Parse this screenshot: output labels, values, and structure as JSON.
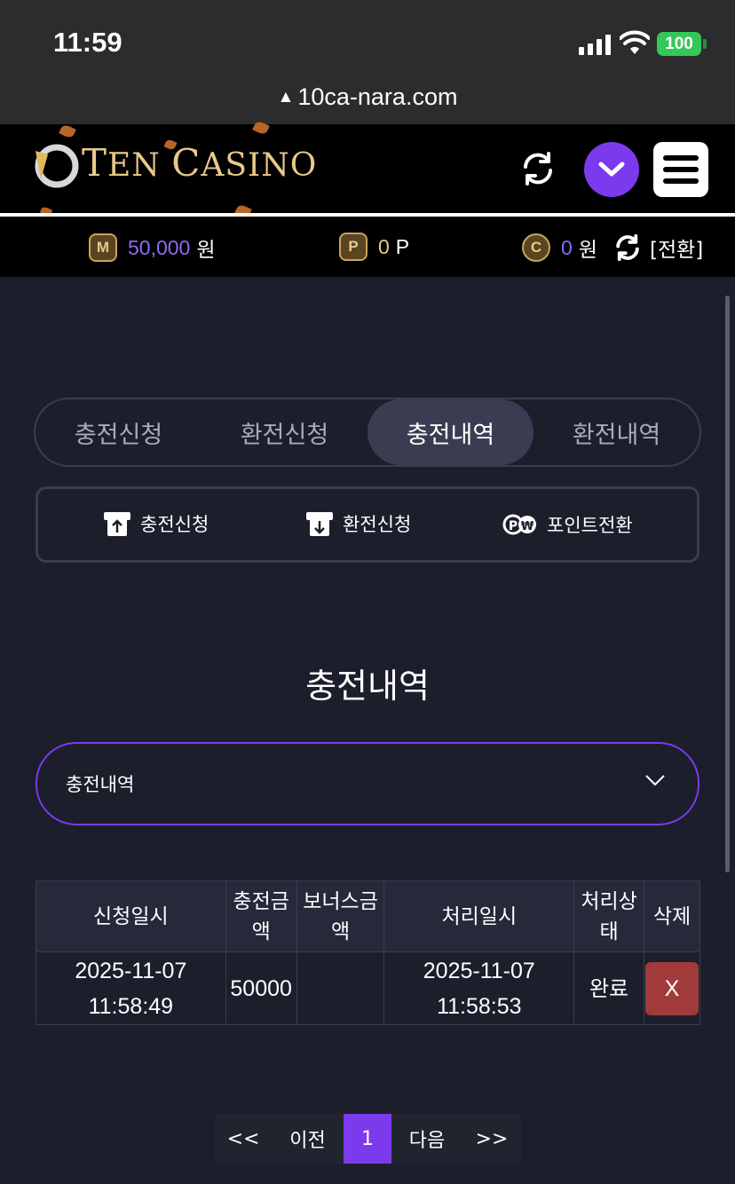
{
  "status": {
    "time": "11:59",
    "battery": "100",
    "url": "10ca-nara.com"
  },
  "header": {
    "logo_first": "T",
    "logo_rest1": "EN ",
    "logo_cap2": "C",
    "logo_rest2": "ASINO"
  },
  "balance": {
    "money_icon": "M",
    "money_value": "50,000",
    "money_unit": "원",
    "point_icon": "P",
    "point_value": "0",
    "point_unit": "P",
    "casino_icon": "C",
    "casino_value": "0",
    "casino_unit": "원",
    "convert_label": "[전환]"
  },
  "tabs": [
    {
      "label": "충전신청",
      "active": false
    },
    {
      "label": "환전신청",
      "active": false
    },
    {
      "label": "충전내역",
      "active": true
    },
    {
      "label": "환전내역",
      "active": false
    }
  ],
  "sub_actions": [
    {
      "label": "충전신청",
      "icon": "deposit-icon"
    },
    {
      "label": "환전신청",
      "icon": "withdraw-icon"
    },
    {
      "label": "포인트전환",
      "icon": "point-convert-icon"
    }
  ],
  "page_title": "충전내역",
  "select": {
    "value": "충전내역"
  },
  "table": {
    "headers": [
      [
        "신청일시"
      ],
      [
        "충전금",
        "액"
      ],
      [
        "보너스금",
        "액"
      ],
      [
        "처리일시"
      ],
      [
        "처리상",
        "태"
      ],
      [
        "삭제"
      ]
    ],
    "rows": [
      {
        "request_date": "2025-11-07",
        "request_time": "11:58:49",
        "amount": "50000",
        "bonus": "",
        "processed_date": "2025-11-07",
        "processed_time": "11:58:53",
        "status": "완료",
        "delete_label": "X"
      }
    ]
  },
  "pagination": {
    "first": "<<",
    "prev": "이전",
    "current": "1",
    "next": "다음",
    "last": ">>"
  },
  "colors": {
    "accent": "#7c3aed",
    "background": "#1c1e2b",
    "delete": "#a13b3b",
    "gold": "#e8c98a"
  }
}
